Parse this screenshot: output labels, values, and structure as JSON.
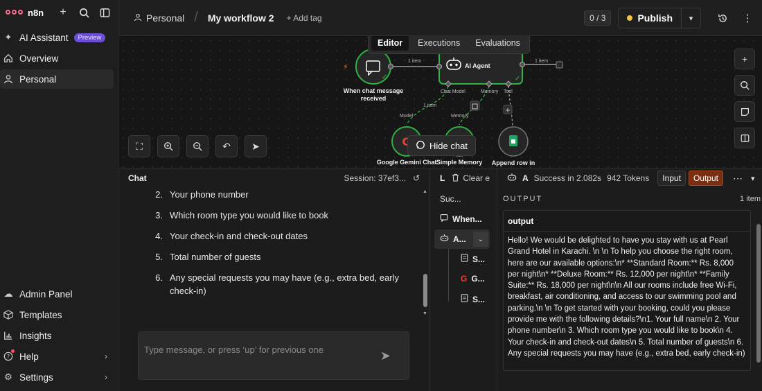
{
  "sidebar": {
    "brand": "n8n",
    "nav_top": [
      {
        "label": "AI Assistant",
        "icon": "sparkle-icon",
        "badge": "Preview"
      },
      {
        "label": "Overview",
        "icon": "home-icon"
      },
      {
        "label": "Personal",
        "icon": "user-icon"
      }
    ],
    "nav_bottom": [
      {
        "label": "Admin Panel",
        "icon": "cloud-icon"
      },
      {
        "label": "Templates",
        "icon": "box-icon"
      },
      {
        "label": "Insights",
        "icon": "chart-icon"
      },
      {
        "label": "Help",
        "icon": "help-icon"
      },
      {
        "label": "Settings",
        "icon": "gear-icon"
      }
    ]
  },
  "header": {
    "project": "Personal",
    "workflow_name": "My workflow 2",
    "add_tag": "+ Add tag",
    "counter": "0 / 3",
    "publish": "Publish"
  },
  "canvas": {
    "tabs": [
      "Editor",
      "Executions",
      "Evaluations"
    ],
    "active_tab": "Editor",
    "nodes": {
      "trigger": "When chat message received",
      "agent": "AI Agent",
      "gemini": "Google Gemini Chat",
      "memory": "Simple Memory",
      "sheet": "Append row in sheet"
    },
    "edge_labels": {
      "trigger_to_agent": "1 item",
      "agent_out": "1 item",
      "model_edge": "1 item"
    },
    "ports": {
      "chat_model": "Chat Model",
      "memory": "Memory",
      "tool": "Tool",
      "model": "Model",
      "memory_in": "Memory"
    },
    "hide_chat": "Hide chat",
    "accent_color": "#2fb344"
  },
  "chat": {
    "title": "Chat",
    "session": "Session: 37ef3...",
    "items": [
      {
        "num": "2.",
        "text": "Your phone number"
      },
      {
        "num": "3.",
        "text": "Which room type you would like to book"
      },
      {
        "num": "4.",
        "text": "Your check-in and check-out dates"
      },
      {
        "num": "5.",
        "text": "Total number of guests"
      },
      {
        "num": "6.",
        "text": "Any special requests you may have (e.g., extra bed, early check-in)"
      }
    ],
    "input_placeholder": "Type message, or press ‘up’ for previous one"
  },
  "logs": {
    "title": "L",
    "clear": "Clear e",
    "rows": [
      {
        "label": "Suc...",
        "icon": ""
      },
      {
        "label": "When...",
        "icon": "chat-icon"
      },
      {
        "label": "A...",
        "icon": "robot-icon"
      },
      {
        "label": "S...",
        "icon": "sheet-icon"
      },
      {
        "label": "G...",
        "icon": "google-icon"
      },
      {
        "label": "S...",
        "icon": "database-icon"
      }
    ]
  },
  "output": {
    "node": "A",
    "status": "Success in 2.082s",
    "tokens": "942 Tokens",
    "input_btn": "Input",
    "output_btn": "Output",
    "section": "OUTPUT",
    "count": "1 item",
    "field": "output",
    "text": "Hello! We would be delighted to have you stay with us at Pearl Grand Hotel in Karachi. \\n \\n To help you choose the right room, here are our available options:\\n* **Standard Room:** Rs. 8,000 per night\\n* **Deluxe Room:** Rs. 12,000 per night\\n* **Family Suite:** Rs. 18,000 per night\\n\\n All our rooms include free Wi-Fi, breakfast, air conditioning, and access to our swimming pool and parking.\\n \\n To get started with your booking, could you please provide me with the following details?\\n1. Your full name\\n 2. Your phone number\\n 3. Which room type you would like to book\\n 4. Your check-in and check-out dates\\n 5. Total number of guests\\n 6. Any special requests you may have (e.g., extra bed, early check-in)"
  }
}
